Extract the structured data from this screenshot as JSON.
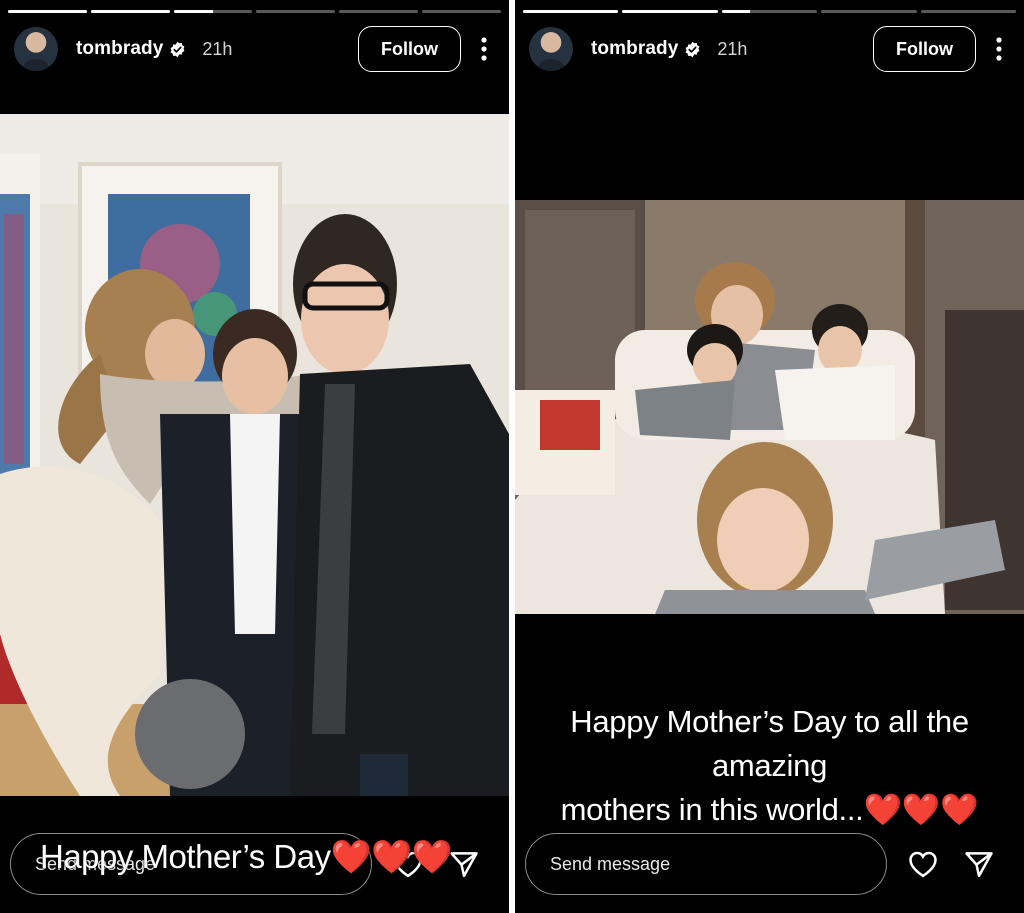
{
  "stories": [
    {
      "username": "tombrady",
      "time": "21h",
      "follow_label": "Follow",
      "progress": [
        1,
        1,
        0.5,
        0,
        0,
        0
      ],
      "caption": "Happy Mother’s Day",
      "caption_hearts": "❤️❤️❤️",
      "message_placeholder": "Send message"
    },
    {
      "username": "tombrady",
      "time": "21h",
      "follow_label": "Follow",
      "progress": [
        1,
        1,
        0.3,
        0,
        0
      ],
      "caption_line1": "Happy Mother’s Day to all the amazing",
      "caption_line2": "mothers in this world...",
      "caption_hearts": "❤️❤️❤️",
      "message_placeholder": "Send message"
    }
  ],
  "icons": {
    "verified": "verified-badge-icon",
    "more": "more-vertical-icon",
    "like": "heart-icon",
    "share": "paper-plane-icon"
  },
  "colors": {
    "background": "#000000",
    "text": "#ffffff",
    "heart": "#e0102a"
  }
}
